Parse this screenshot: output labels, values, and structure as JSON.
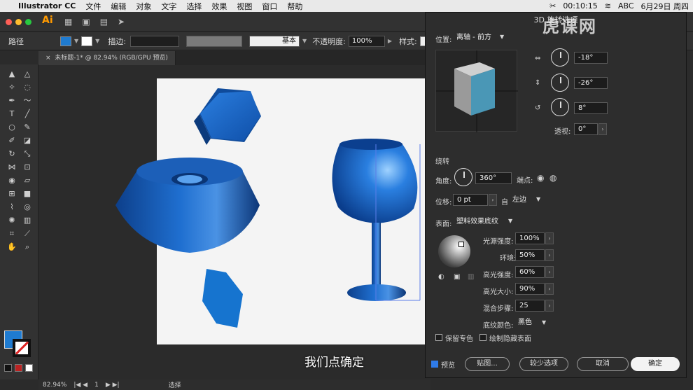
{
  "menubar": {
    "app_name": "Illustrator CC",
    "items": [
      "文件",
      "编辑",
      "对象",
      "文字",
      "选择",
      "效果",
      "视图",
      "窗口",
      "帮助"
    ],
    "time": "00:10:15",
    "input": "ABC",
    "date": "6月29日 周四"
  },
  "app": {
    "logo": "Ai"
  },
  "control_bar": {
    "object_type": "路径",
    "stroke_label": "描边:",
    "stroke_style": "基本",
    "opacity_label": "不透明度:",
    "opacity_value": "100%",
    "style_label": "样式:",
    "fill_color": "#1f7bd0"
  },
  "document_tab": {
    "label": "未标题-1* @ 82.94% (RGB/GPU 预览)"
  },
  "status_bar": {
    "zoom": "82.94%",
    "artboard": "1",
    "tool": "选择"
  },
  "dialog": {
    "title": "3D 旋转选项",
    "position_label": "位置:",
    "position_value": "离轴 - 前方",
    "x_angle": "-18°",
    "y_angle": "-26°",
    "z_angle": "8°",
    "perspective_label": "透视:",
    "perspective_value": "0°",
    "revolve_section": "绕转",
    "angle_label": "角度:",
    "angle_value": "360°",
    "cap_label": "端点:",
    "offset_label": "位移:",
    "offset_value": "0 pt",
    "from_label": "自",
    "from_value": "左边",
    "surface_label": "表面:",
    "surface_value": "塑料效果底纹",
    "light_intensity_label": "光源强度:",
    "light_intensity_value": "100%",
    "ambient_label": "环境光:",
    "ambient_value": "50%",
    "highlight_intensity_label": "高光强度:",
    "highlight_intensity_value": "60%",
    "highlight_size_label": "高光大小:",
    "highlight_size_value": "90%",
    "blend_steps_label": "混合步骤:",
    "blend_steps_value": "25",
    "shade_color_label": "底纹颜色:",
    "shade_color_value": "黑色",
    "preserve_spot": "保留专色",
    "draw_hidden": "绘制隐藏表面",
    "preview": "预览",
    "map_art": "贴图...",
    "fewer_options": "较少选项",
    "cancel": "取消",
    "ok": "确定"
  },
  "subtitle": "我们点确定",
  "watermark": "虎课网"
}
